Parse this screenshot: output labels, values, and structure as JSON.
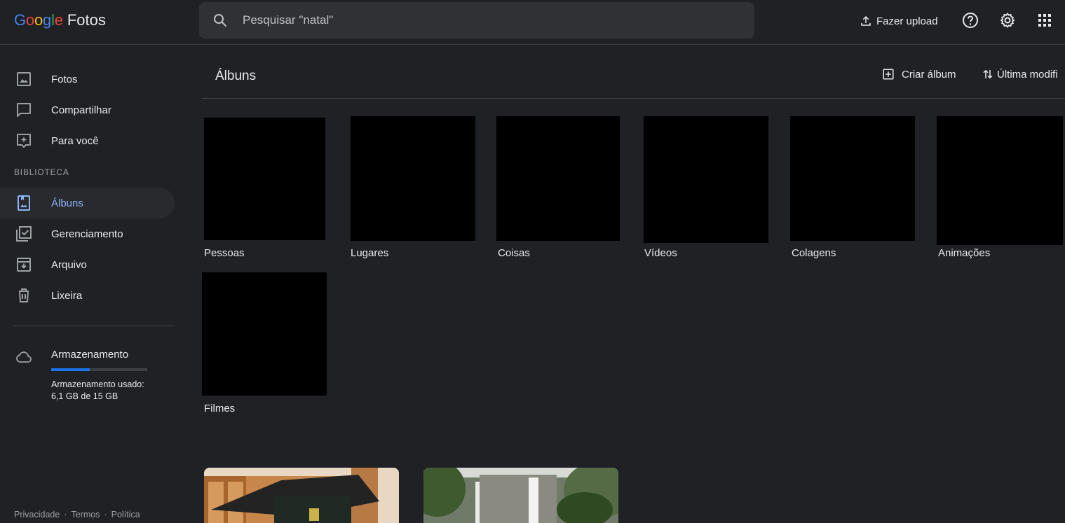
{
  "app": {
    "logo_google": "Google",
    "product_name": "Fotos"
  },
  "header": {
    "search_placeholder": "Pesquisar \"natal\"",
    "upload_label": "Fazer upload"
  },
  "sidebar": {
    "items": [
      {
        "label": "Fotos",
        "icon": "photo-icon"
      },
      {
        "label": "Compartilhar",
        "icon": "share-chat-icon"
      },
      {
        "label": "Para você",
        "icon": "for-you-icon"
      }
    ],
    "library_title": "BIBLIOTECA",
    "library_items": [
      {
        "label": "Álbuns",
        "icon": "albums-icon",
        "active": true
      },
      {
        "label": "Gerenciamento",
        "icon": "manage-icon"
      },
      {
        "label": "Arquivo",
        "icon": "archive-icon"
      },
      {
        "label": "Lixeira",
        "icon": "trash-icon"
      }
    ],
    "storage": {
      "title": "Armazenamento",
      "used_fraction": 0.4,
      "text": "Armazenamento usado: 6,1 GB de 15 GB"
    },
    "footer": [
      "Privacidade",
      "Termos",
      "Política"
    ]
  },
  "main": {
    "title": "Álbuns",
    "create_album_label": "Criar álbum",
    "sort_label": "Última modifi",
    "categories": [
      "Pessoas",
      "Lugares",
      "Coisas",
      "Vídeos",
      "Colagens",
      "Animações",
      "Filmes"
    ]
  },
  "colors": {
    "background": "#202124",
    "accent": "#8ab4f8",
    "storage_fill": "#1a73e8"
  }
}
